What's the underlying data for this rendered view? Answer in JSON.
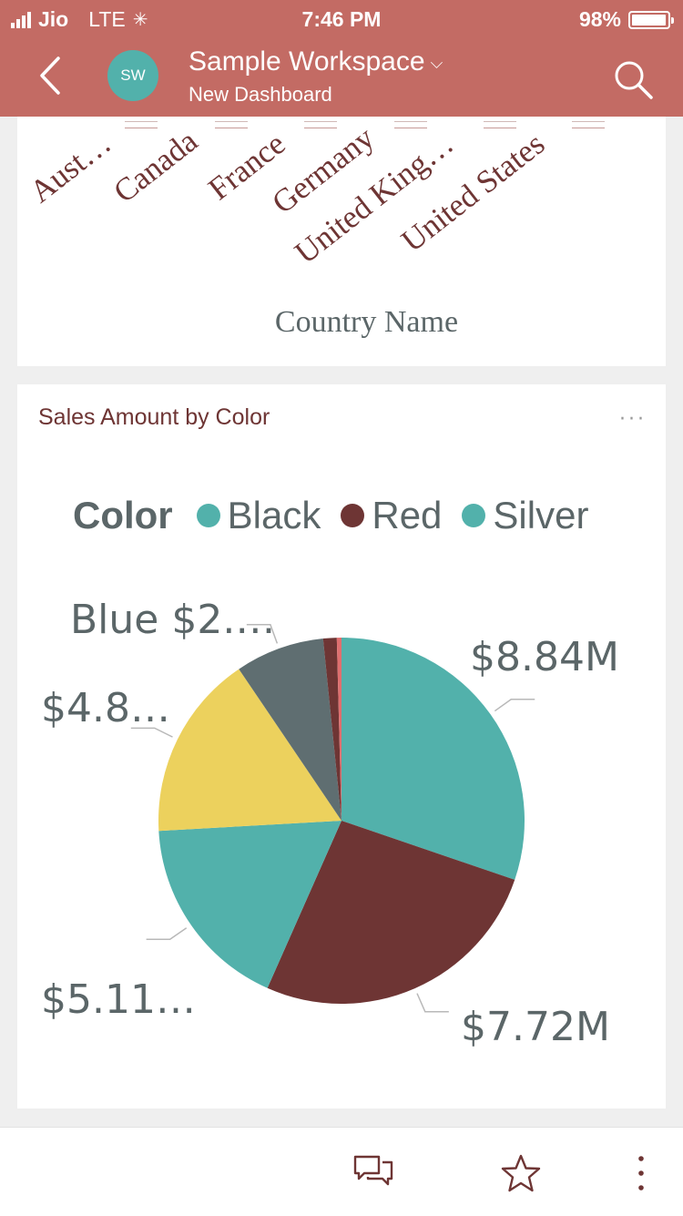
{
  "status_bar": {
    "carrier": "Jio",
    "network": "LTE",
    "time": "7:46 PM",
    "battery": "98%",
    "battery_level": 0.98
  },
  "header": {
    "avatar_initials": "SW",
    "workspace": "Sample Workspace",
    "dashboard": "New Dashboard"
  },
  "country_chart": {
    "countries": [
      "Aust…",
      "Canada",
      "France",
      "Germany",
      "United King…",
      "United States"
    ],
    "axis_title": "Country Name"
  },
  "color_card": {
    "title": "Sales Amount by Color",
    "more_label": "···",
    "legend_title": "Color",
    "legend": [
      {
        "label": "Black",
        "color": "#52b1ab"
      },
      {
        "label": "Red",
        "color": "#6e3534"
      },
      {
        "label": "Silver",
        "color": "#52b1ab"
      }
    ]
  },
  "chart_data": {
    "type": "pie",
    "title": "Sales Amount by Color",
    "legend_title": "Color",
    "legend_position": "top",
    "slices": [
      {
        "label": "$8.84M",
        "value": 8.84,
        "color": "#52b1ab"
      },
      {
        "label": "$7.72M",
        "value": 7.72,
        "color": "#6e3534"
      },
      {
        "label": "$5.11…",
        "value": 5.11,
        "color": "#52b1ab"
      },
      {
        "label": "$4.8…",
        "value": 4.8,
        "color": "#ecd15d"
      },
      {
        "label": "Blue $2.…",
        "value": 2.3,
        "color": "#5f6e71"
      },
      {
        "label": "",
        "value": 0.35,
        "color": "#6e3534"
      },
      {
        "label": "",
        "value": 0.12,
        "color": "#e06f6f"
      }
    ]
  },
  "bottom_bar": {
    "icons": [
      "comments-icon",
      "favorite-star-icon",
      "more-vertical-icon"
    ]
  }
}
